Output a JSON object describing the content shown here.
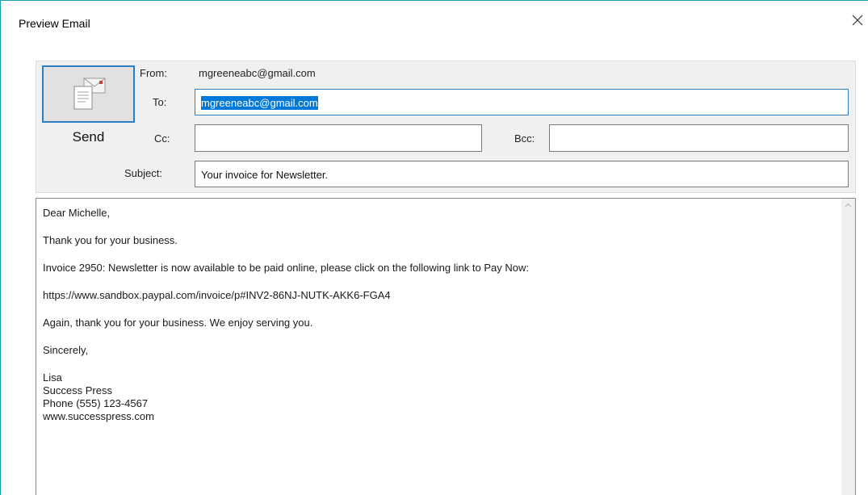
{
  "window": {
    "title": "Preview Email"
  },
  "send_button": {
    "label": "Send",
    "icon": "send-mail-icon"
  },
  "from": {
    "label": "From:",
    "value": "mgreeneabc@gmail.com"
  },
  "to": {
    "label": "To:",
    "value": "mgreeneabc@gmail.com",
    "selected": true
  },
  "cc": {
    "label": "Cc:",
    "value": ""
  },
  "bcc": {
    "label": "Bcc:",
    "value": ""
  },
  "subject": {
    "label": "Subject:",
    "value": "Your invoice for Newsletter."
  },
  "body": {
    "greeting": "Dear Michelle,",
    "thanks": "Thank you for your business.",
    "invoice_line": "Invoice 2950: Newsletter is now available to be paid online, please click on the following link to Pay Now:",
    "link": "https://www.sandbox.paypal.com/invoice/p#INV2-86NJ-NUTK-AKK6-FGA4",
    "closing_line": "Again, thank you for your business. We enjoy serving you.",
    "signoff": "Sincerely,",
    "signature": {
      "name": "Lisa",
      "company": "Success Press",
      "phone": "Phone (555) 123-4567",
      "website": "www.successpress.com"
    }
  },
  "colors": {
    "accent": "#2e7ec4",
    "selection": "#0078d7",
    "panel_bg": "#f0f0f0"
  }
}
